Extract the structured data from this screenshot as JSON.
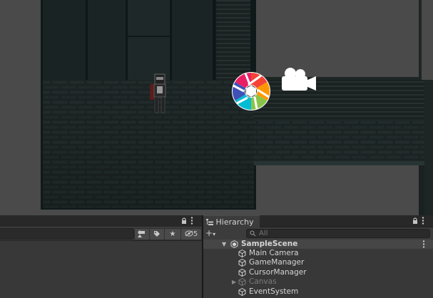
{
  "hierarchy": {
    "tab_label": "Hierarchy",
    "add_label": "+",
    "search_placeholder": "All",
    "scene_name": "SampleScene",
    "items": [
      {
        "label": "Main Camera",
        "active": true
      },
      {
        "label": "GameManager",
        "active": true
      },
      {
        "label": "CursorManager",
        "active": true
      },
      {
        "label": "Canvas",
        "active": false,
        "has_children": true
      },
      {
        "label": "EventSystem",
        "active": true
      }
    ]
  },
  "project": {
    "hidden_count": "5"
  },
  "icons": {
    "scene": "unity-scene-icon",
    "game_object": "cube-icon",
    "camera_gizmo": "camera-icon",
    "post_process_gizmo": "shutter-icon",
    "lock": "lock-icon",
    "menu": "kebab-menu-icon"
  },
  "colors": {
    "scene_bg": "#4a4a4a",
    "dungeon_wall": "#1d2525",
    "panel_bg": "#383838",
    "selection": "#464646"
  }
}
